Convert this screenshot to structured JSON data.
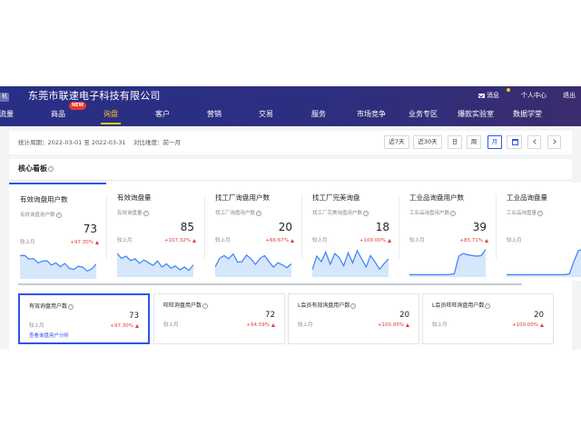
{
  "header": {
    "brand_tag": "机",
    "company": "东莞市联速电子科技有限公司",
    "messages": "消息",
    "user_center": "个人中心",
    "logout": "退出",
    "new_badge": "NEW",
    "nav": [
      "流量",
      "商品",
      "询盘",
      "客户",
      "营销",
      "交易",
      "服务",
      "市场竞争",
      "业务专区",
      "爆款实验室",
      "数据学堂"
    ],
    "active_nav": "询盘"
  },
  "filter": {
    "period_label": "统计周期：2022-03-01 至 2022-03-31",
    "compare_label": "对比维度：前一月",
    "btn_7d": "近7天",
    "btn_30d": "近30天",
    "btn_day": "日",
    "btn_week": "周",
    "btn_month": "月",
    "active": "月"
  },
  "panel": {
    "title": "核心看板",
    "cards": [
      {
        "title": "有效询盘用户数",
        "sub": "有效询盘用户数",
        "value": "73",
        "compare": "较上月",
        "pct": "+97.30%",
        "trend": [
          0.78,
          0.8,
          0.66,
          0.68,
          0.52,
          0.58,
          0.6,
          0.44,
          0.52,
          0.38,
          0.5,
          0.32,
          0.28,
          0.4,
          0.36,
          0.22,
          0.3,
          0.48
        ]
      },
      {
        "title": "有效询盘量",
        "sub": "有效询盘量",
        "value": "85",
        "compare": "较上月",
        "pct": "+107.32%",
        "trend": [
          0.8,
          0.62,
          0.7,
          0.54,
          0.6,
          0.44,
          0.56,
          0.46,
          0.36,
          0.52,
          0.3,
          0.42,
          0.26,
          0.34,
          0.2,
          0.3,
          0.18,
          0.38
        ]
      },
      {
        "title": "找工厂询盘用户数",
        "sub": "找工厂询盘用户数",
        "value": "20",
        "compare": "较上月",
        "pct": "+66.67%",
        "trend": [
          0.3,
          0.62,
          0.72,
          0.6,
          0.78,
          0.48,
          0.5,
          0.74,
          0.6,
          0.4,
          0.62,
          0.72,
          0.5,
          0.3,
          0.46,
          0.38,
          0.28,
          0.42
        ]
      },
      {
        "title": "找工厂完美询盘",
        "sub": "找工厂完美询盘用户数",
        "value": "18",
        "compare": "较上月",
        "pct": "+100.00%",
        "trend": [
          0.2,
          0.7,
          0.5,
          0.85,
          0.4,
          0.8,
          0.65,
          0.35,
          0.82,
          0.45,
          0.9,
          0.6,
          0.3,
          0.72,
          0.48,
          0.22,
          0.42,
          0.6
        ]
      },
      {
        "title": "工业品询盘用户数",
        "sub": "工业品询盘用户数",
        "value": "39",
        "compare": "较上月",
        "pct": "+85.71%",
        "trend": [
          0.02,
          0.02,
          0.02,
          0.02,
          0.02,
          0.02,
          0.02,
          0.02,
          0.02,
          0.03,
          0.05,
          0.7,
          0.8,
          0.75,
          0.72,
          0.7,
          0.72,
          0.95
        ]
      },
      {
        "title": "工业品询盘量",
        "sub": "工业品询盘量",
        "value": "",
        "compare": "较上月",
        "pct": "",
        "trend": [
          0.02,
          0.02,
          0.02,
          0.02,
          0.02,
          0.02,
          0.02,
          0.02,
          0.02,
          0.02,
          0.02,
          0.02,
          0.02,
          0.02,
          0.05,
          0.5,
          0.9,
          0.95
        ]
      }
    ],
    "cards2": [
      {
        "title": "有效询盘用户数",
        "value": "73",
        "compare": "较上月",
        "pct": "+97.30%",
        "link": "查看询盘用户分析"
      },
      {
        "title": "旺旺询盘用户数",
        "value": "72",
        "compare": "较上月",
        "pct": "+94.59%"
      },
      {
        "title": "L会员有效询盘用户数",
        "value": "20",
        "compare": "较上月",
        "pct": "+100.00%"
      },
      {
        "title": "L会员旺旺询盘用户数",
        "value": "20",
        "compare": "较上月",
        "pct": "+100.00%"
      }
    ]
  },
  "colors": {
    "accent": "#2f54eb",
    "up": "#e53935",
    "nav_active": "#f5c518",
    "chart_line": "#3b82f6",
    "chart_fill": "#d6e6fb"
  }
}
